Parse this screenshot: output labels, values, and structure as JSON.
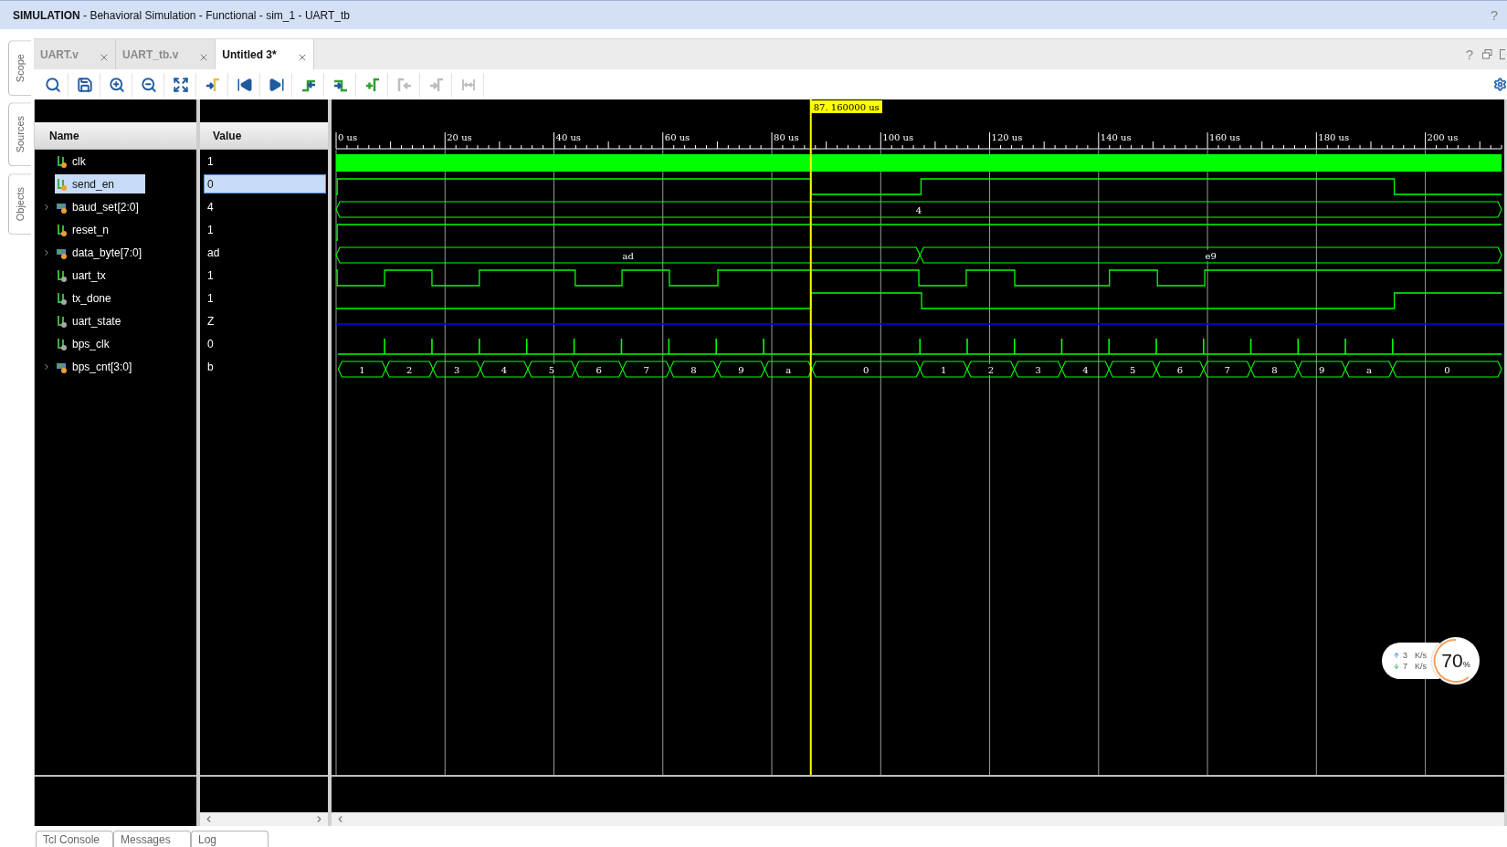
{
  "title_bar": {
    "title": "**SIMULATION** - Behavioral Simulation - Functional - sim_1 - UART_tb",
    "help": "?"
  },
  "side_tabs": [
    {
      "label": "Scope"
    },
    {
      "label": "Sources"
    },
    {
      "label": "Objects"
    }
  ],
  "editor_tabs": [
    {
      "label": "UART.v",
      "selected": false
    },
    {
      "label": "UART_tb.v",
      "selected": false
    },
    {
      "label": "Untitled 3*",
      "selected": true
    }
  ],
  "editor_help": "?",
  "toolbar": [
    {
      "kind": "search",
      "disabled": false
    },
    {
      "kind": "save",
      "disabled": false
    },
    {
      "kind": "zoom-in",
      "disabled": false
    },
    {
      "kind": "zoom-out",
      "disabled": false
    },
    {
      "kind": "zoom-fit",
      "disabled": false
    },
    {
      "kind": "go-to-cursor",
      "disabled": false
    },
    {
      "kind": "go-to-start",
      "disabled": false
    },
    {
      "kind": "go-to-end",
      "disabled": false
    },
    {
      "kind": "previous-transition",
      "disabled": false
    },
    {
      "kind": "next-transition",
      "disabled": false
    },
    {
      "kind": "add-marker",
      "disabled": false
    },
    {
      "kind": "previous-marker",
      "disabled": true
    },
    {
      "kind": "next-marker",
      "disabled": true
    },
    {
      "kind": "swap-cursors",
      "disabled": true
    }
  ],
  "columns": {
    "name": "Name",
    "value": "Value"
  },
  "signals": [
    {
      "name": "clk",
      "value": "1",
      "kind": "clock",
      "color": "#f0a030",
      "selected": false
    },
    {
      "name": "send_en",
      "value": "0",
      "kind": "bit",
      "color": "#f0a030",
      "selected": true
    },
    {
      "name": "baud_set[2:0]",
      "value": "4",
      "kind": "bus",
      "color": "#f0a030",
      "selected": false,
      "expanded": false,
      "segments": [
        "4"
      ]
    },
    {
      "name": "reset_n",
      "value": "1",
      "kind": "bit",
      "color": "#f0a030",
      "selected": false
    },
    {
      "name": "data_byte[7:0]",
      "value": "ad",
      "kind": "bus",
      "color": "#f0a030",
      "selected": false,
      "expanded": false,
      "segments": [
        "ad",
        "e9"
      ]
    },
    {
      "name": "uart_tx",
      "value": "1",
      "kind": "bit",
      "color": "#a8a8a8",
      "selected": false
    },
    {
      "name": "tx_done",
      "value": "1",
      "kind": "bit",
      "color": "#a8a8a8",
      "selected": false
    },
    {
      "name": "uart_state",
      "value": "Z",
      "kind": "highz",
      "color": "#a8a8a8",
      "selected": false
    },
    {
      "name": "bps_clk",
      "value": "0",
      "kind": "pulse",
      "color": "#a8a8a8",
      "selected": false
    },
    {
      "name": "bps_cnt[3:0]",
      "value": "b",
      "kind": "bus",
      "color": "#f0a030",
      "selected": false,
      "expanded": false,
      "segments": [
        "1",
        "2",
        "3",
        "4",
        "5",
        "6",
        "7",
        "8",
        "9",
        "a",
        "0",
        "1",
        "2",
        "3",
        "4",
        "5",
        "6",
        "7",
        "8",
        "9",
        "a",
        "0"
      ]
    }
  ],
  "ruler": [
    "0 us",
    "20 us",
    "40 us",
    "60 us",
    "80 us",
    "100 us",
    "120 us",
    "140 us",
    "160 us",
    "180 us",
    "200 us"
  ],
  "cursor": {
    "time": "87. 160000 us"
  },
  "speed_widget": {
    "up_rate": "3",
    "up_unit": "K/s",
    "down_rate": "7",
    "down_unit": "K/s",
    "percent": "70",
    "percent_sign": "%"
  },
  "bottom_tabs": [
    {
      "label": "Tcl Console"
    },
    {
      "label": "Messages"
    },
    {
      "label": "Log"
    }
  ]
}
